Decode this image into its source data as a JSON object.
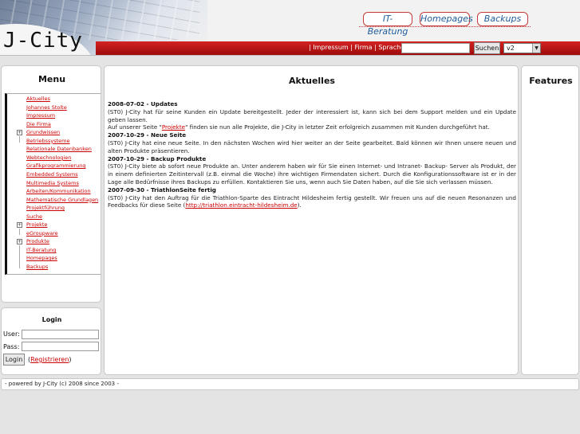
{
  "header": {
    "logo": "J-City",
    "nav": [
      "IT-Beratung",
      "Homepages",
      "Backups"
    ],
    "toplinks": "| Impressum | Firma | Sprache |",
    "search_button": "Suchen",
    "version": "v2"
  },
  "menu": {
    "title": "Menu",
    "items": [
      {
        "label": "Aktuelles",
        "plus": false
      },
      {
        "label": "Johannes Stolte",
        "plus": false
      },
      {
        "label": "Impressum",
        "plus": false
      },
      {
        "label": "Die Firma",
        "plus": false
      },
      {
        "label": "Grundwissen",
        "plus": true
      },
      {
        "label": "Betriebssysteme",
        "plus": false
      },
      {
        "label": "Relationale Datenbanken",
        "plus": false
      },
      {
        "label": "Webtechnologien",
        "plus": false
      },
      {
        "label": "Grafikprogrammierung",
        "plus": false
      },
      {
        "label": "Embedded Systems",
        "plus": false
      },
      {
        "label": "Multimedia Systems",
        "plus": false
      },
      {
        "label": "Arbeiten/Kommunikation",
        "plus": false
      },
      {
        "label": "Mathematische Grundlagen",
        "plus": false
      },
      {
        "label": "Projektführung",
        "plus": false
      },
      {
        "label": "Suche",
        "plus": false
      },
      {
        "label": "Projekte",
        "plus": true
      },
      {
        "label": "eGroupware",
        "plus": false
      },
      {
        "label": "Produkte",
        "plus": true
      },
      {
        "label": "IT-Beratung",
        "plus": false
      },
      {
        "label": "Homepages",
        "plus": false
      },
      {
        "label": "Backups",
        "plus": false
      }
    ]
  },
  "login": {
    "title": "Login",
    "user_label": "User:",
    "pass_label": "Pass:",
    "button": "Login",
    "register_open": "(",
    "register": "Registrieren",
    "register_close": ")"
  },
  "content": {
    "title": "Aktuelles",
    "news": [
      {
        "head": "2008-07-02 - Updates",
        "lines": [
          {
            "parts": [
              {
                "t": "(ST0) J-City hat für seine Kunden ein Update bereitgestellt. Jeder der interessiert ist, kann sich bei dem Support melden und ein Update geben lassen."
              }
            ]
          },
          {
            "parts": [
              {
                "t": "Auf unserer Seite \""
              },
              {
                "t": "Projekte",
                "link": true
              },
              {
                "t": "\" finden sie nun alle Projekte, die J-City in letzter Zeit erfolgreich zusammen mit Kunden durchgeführt hat."
              }
            ]
          }
        ]
      },
      {
        "head": "2007-10-29 - Neue Seite",
        "lines": [
          {
            "parts": [
              {
                "t": "(ST0) J-City hat eine neue Seite. In den nächsten Wochen wird hier weiter an der Seite gearbeitet. Bald können wir Ihnen unsere neuen und alten Produkte präsentieren."
              }
            ]
          }
        ]
      },
      {
        "head": "2007-10-29 - Backup Produkte",
        "lines": [
          {
            "parts": [
              {
                "t": "(ST0) J-City biete ab sofort neue Produkte an. Unter anderem haben wir für Sie einen Internet- und Intranet- Backup- Server als Produkt, der in einem definierten Zeitintervall (z.B. einmal die Woche) ihre wichtigen Firmendaten sichert. Durch die Konfigurationssoftware ist er in der Lage alle Bedürfnisse ihres Backups zu erfüllen. Kontaktieren Sie uns, wenn auch Sie Daten haben, auf die Sie sich verlassen müssen."
              }
            ]
          }
        ]
      },
      {
        "head": "2007-09-30 - TriathlonSeite fertig",
        "lines": [
          {
            "parts": [
              {
                "t": "(ST0) J-City hat den Auftrag für die Triathlon-Sparte des Eintracht Hildesheim fertig gestellt. Wir freuen uns auf die neuen Resonanzen und Feedbacks für diese Seite ("
              },
              {
                "t": "http://triathlon.eintracht-hildesheim.de",
                "link": true
              },
              {
                "t": ")."
              }
            ]
          }
        ]
      }
    ]
  },
  "features": {
    "title": "Features"
  },
  "footer": "- powered by J-City (c) 2008 since 2003 -"
}
